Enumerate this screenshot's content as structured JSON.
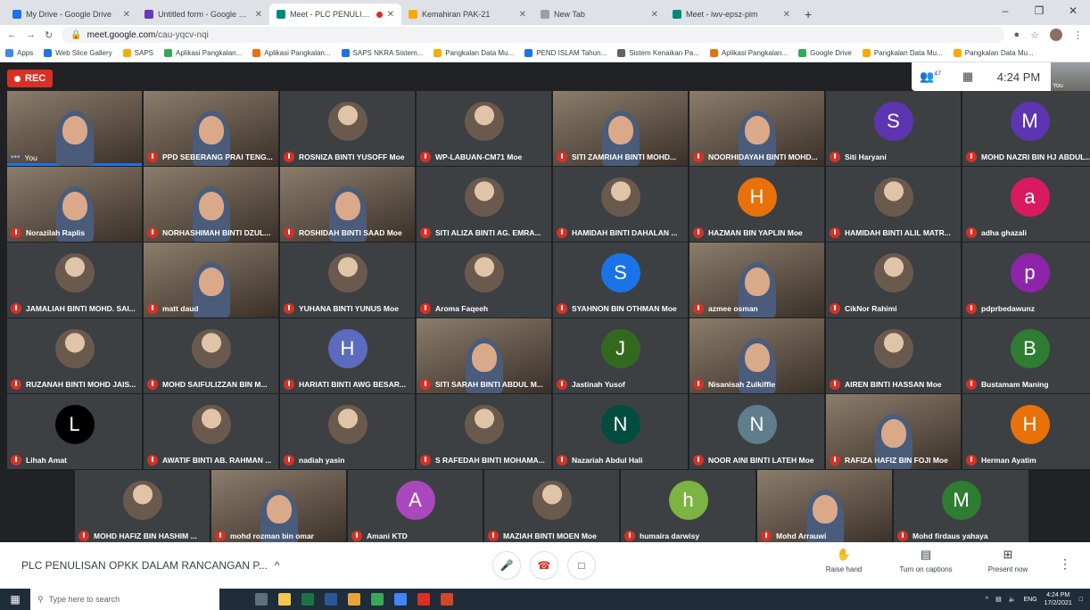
{
  "browser": {
    "tabs": [
      {
        "title": "My Drive - Google Drive",
        "color": "#1a73e8"
      },
      {
        "title": "Untitled form - Google Forms",
        "color": "#673ab7"
      },
      {
        "title": "Meet - PLC PENULISAN OPK",
        "color": "#00897b",
        "active": true
      },
      {
        "title": "Kemahiran PAK-21",
        "color": "#f9ab00"
      },
      {
        "title": "New Tab",
        "color": "#9aa0a6"
      },
      {
        "title": "Meet - iwv-epsz-pim",
        "color": "#00897b"
      }
    ],
    "url_host": "meet.google.com",
    "url_path": "/cau-yqcv-nqi",
    "bookmarks": [
      "Apps",
      "Web Slice Gallery",
      "SAPS",
      "Aplikasi Pangkalan...",
      "Aplikasi Pangkalan...",
      "SAPS NKRA Sistem...",
      "Pangkalan Data Mu...",
      "PEND ISLAM Tahun...",
      "Sistem Kenaikan Pa...",
      "Aplikasi Pangkalan...",
      "Google Drive",
      "Pangkalan Data Mu...",
      "Pangkalan Data Mu..."
    ]
  },
  "meet": {
    "rec_label": "REC",
    "participant_count": "47",
    "clock": "4:24 PM",
    "self_thumb_label": "You",
    "meeting_title": "PLC PENULISAN OPKK DALAM RANCANGAN P...",
    "controls": {
      "raise_hand": "Raise hand",
      "captions": "Turn on captions",
      "present": "Present now"
    },
    "rows": [
      [
        {
          "name": "You",
          "kind": "video",
          "self": true
        },
        {
          "name": "PPD SEBERANG PRAI TENG...",
          "kind": "video"
        },
        {
          "name": "ROSNIZA BINTI YUSOFF Moe",
          "kind": "photo"
        },
        {
          "name": "WP-LABUAN-CM71 Moe",
          "kind": "photo"
        },
        {
          "name": "SITI ZAMRIAH BINTI MOHD...",
          "kind": "video"
        },
        {
          "name": "NOORHIDAYAH BINTI MOHD...",
          "kind": "video"
        },
        {
          "name": "Siti Haryani",
          "kind": "letter",
          "letter": "S",
          "color": "#5e35b1"
        },
        {
          "name": "MOHD NAZRI BIN HJ ABDUL...",
          "kind": "letter",
          "letter": "M",
          "color": "#5e35b1"
        }
      ],
      [
        {
          "name": "Norazilah Raplis",
          "kind": "video"
        },
        {
          "name": "NORHASHIMAH BINTI DZUL...",
          "kind": "video"
        },
        {
          "name": "ROSHIDAH BINTI SAAD Moe",
          "kind": "video"
        },
        {
          "name": "SITI ALIZA BINTI AG. EMRA...",
          "kind": "photo"
        },
        {
          "name": "HAMIDAH BINTI DAHALAN ...",
          "kind": "photo"
        },
        {
          "name": "HAZMAN BIN YAPLIN Moe",
          "kind": "letter",
          "letter": "H",
          "color": "#e8710a"
        },
        {
          "name": "HAMIDAH BINTI ALIL MATR...",
          "kind": "photo"
        },
        {
          "name": "adha ghazali",
          "kind": "letter",
          "letter": "a",
          "color": "#d81b60"
        }
      ],
      [
        {
          "name": "JAMALIAH BINTI MOHD. SAI...",
          "kind": "photo"
        },
        {
          "name": "matt daud",
          "kind": "video"
        },
        {
          "name": "YUHANA BINTI YUNUS Moe",
          "kind": "photo"
        },
        {
          "name": "Aroma Faqeeh",
          "kind": "photo"
        },
        {
          "name": "SYAHNON BIN OTHMAN Moe",
          "kind": "letter",
          "letter": "S",
          "color": "#1a73e8"
        },
        {
          "name": "azmee osman",
          "kind": "video"
        },
        {
          "name": "CikNor Rahimi",
          "kind": "photo"
        },
        {
          "name": "pdprbedawunz",
          "kind": "letter",
          "letter": "p",
          "color": "#8e24aa"
        }
      ],
      [
        {
          "name": "RUZANAH BINTI MOHD JAIS...",
          "kind": "photo"
        },
        {
          "name": "MOHD SAIFULIZZAN BIN M...",
          "kind": "photo"
        },
        {
          "name": "HARIATI BINTI AWG BESAR...",
          "kind": "letter",
          "letter": "H",
          "color": "#5c6bc0"
        },
        {
          "name": "SITI SARAH BINTI ABDUL M...",
          "kind": "video"
        },
        {
          "name": "Jastinah Yusof",
          "kind": "letter",
          "letter": "J",
          "color": "#33691e"
        },
        {
          "name": "Nisanisah Zulkiffle",
          "kind": "video"
        },
        {
          "name": "AIREN BINTI HASSAN Moe",
          "kind": "photo"
        },
        {
          "name": "Bustamam Maning",
          "kind": "letter",
          "letter": "B",
          "color": "#2e7d32"
        }
      ],
      [
        {
          "name": "Lihah Amat",
          "kind": "letter",
          "letter": "L",
          "color": "#000000"
        },
        {
          "name": "AWATIF BINTI AB. RAHMAN ...",
          "kind": "photo"
        },
        {
          "name": "nadiah yasin",
          "kind": "photo"
        },
        {
          "name": "S RAFEDAH BINTI MOHAMA...",
          "kind": "photo"
        },
        {
          "name": "Nazariah Abdul Hali",
          "kind": "letter",
          "letter": "N",
          "color": "#004d40"
        },
        {
          "name": "NOOR AINI BINTI LATEH Moe",
          "kind": "letter",
          "letter": "N",
          "color": "#607d8b"
        },
        {
          "name": "RAFIZA HAFIZ BIN FOJI Moe",
          "kind": "video"
        },
        {
          "name": "Herman Ayatim",
          "kind": "letter",
          "letter": "H",
          "color": "#e8710a"
        }
      ],
      [
        {
          "name": "MOHD HAFIZ BIN HASHIM ...",
          "kind": "photo"
        },
        {
          "name": "mohd rozman bin omar",
          "kind": "video"
        },
        {
          "name": "Amani KTD",
          "kind": "letter",
          "letter": "A",
          "color": "#ab47bc"
        },
        {
          "name": "MAZIAH BINTI MOEN Moe",
          "kind": "photo"
        },
        {
          "name": "humaira darwisy",
          "kind": "letter",
          "letter": "h",
          "color": "#7cb342"
        },
        {
          "name": "Mohd Arrauwi",
          "kind": "video"
        },
        {
          "name": "Mohd firdaus yahaya",
          "kind": "letter",
          "letter": "M",
          "color": "#2e7d32"
        }
      ]
    ]
  },
  "taskbar": {
    "search_placeholder": "Type here to search",
    "lang": "ENG",
    "time": "4:24 PM",
    "date": "17/2/2021"
  }
}
